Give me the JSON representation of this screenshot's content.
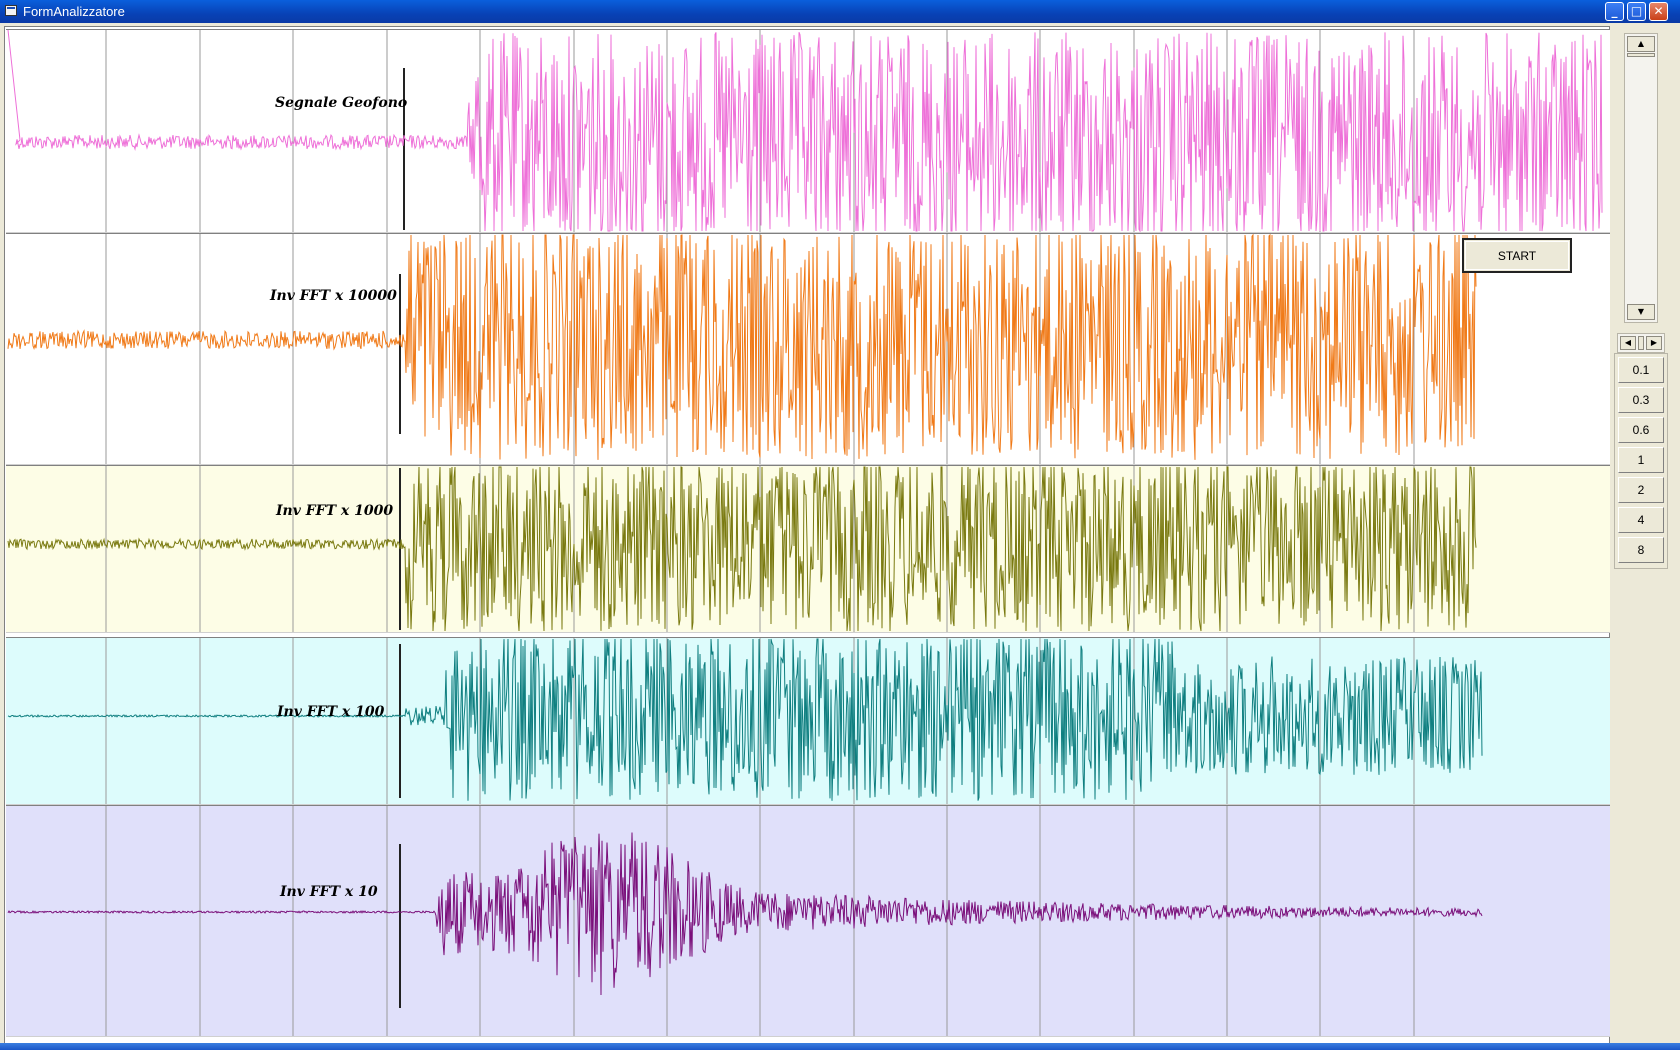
{
  "window": {
    "title": "FormAnalizzatore"
  },
  "panels": [
    {
      "id": "geofono",
      "label": "Segnale Geofono",
      "color": "#ee70d8",
      "background": "#ffffff"
    },
    {
      "id": "fft10000",
      "label": "Inv FFT x 10000",
      "color": "#f07a18",
      "background": "#ffffff"
    },
    {
      "id": "fft1000",
      "label": "Inv FFT x 1000",
      "color": "#7a7a10",
      "background": "#fdfde6"
    },
    {
      "id": "fft100",
      "label": "Inv FFT x 100",
      "color": "#0f7f80",
      "background": "#ddfcfc"
    },
    {
      "id": "fft10",
      "label": "Inv FFT x 10",
      "color": "#7a0f7a",
      "background": "#e0e0fa"
    }
  ],
  "controls": {
    "start_label": "START",
    "scales": [
      "0.1",
      "0.3",
      "0.6",
      "1",
      "2",
      "4",
      "8"
    ]
  },
  "colors": {
    "grid": "#9a9a9a",
    "marker": "#222222"
  }
}
